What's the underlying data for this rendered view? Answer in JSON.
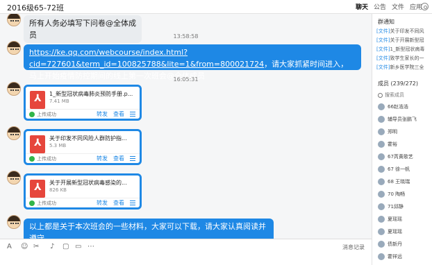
{
  "window": {
    "title": "2016级65-72班"
  },
  "tabs": [
    "聊天",
    "公告",
    "文件",
    "应用"
  ],
  "colors": {
    "bubble_blue": "#1e88e5",
    "bubble_grey": "#e9ecef",
    "pdf_red": "#e6463c",
    "ok_green": "#32b54a"
  },
  "messages": {
    "m1": "所有人务必填写下问卷@全体成员",
    "t1": "13:58:58",
    "m2_link": "https://ke.qq.com/webcourse/index.html?cid=727601&term_id=100825788&lite=1&from=800021724",
    "m2_text": "，请大家抓紧时间进入，马上开始疫情防控期间的线上第一次班会@全体成员",
    "t2": "16:05:31",
    "m3": "以上都是关于本次班会的一些材料，大家可以下载，请大家认真阅读并遵守"
  },
  "files": [
    {
      "name": "1_新型冠状病毒肺炎预防手册.p...",
      "size": "7.41 MB",
      "status": "上传成功",
      "forward": "转发",
      "view": "查看"
    },
    {
      "name": "关于印发不同风险人群防护指...",
      "size": "5.3 MB",
      "status": "上传成功",
      "forward": "转发",
      "view": "查看"
    },
    {
      "name": "关于开展新型冠状病毒感染的...",
      "size": "826 KB",
      "status": "上传成功",
      "forward": "转发",
      "view": "查看"
    }
  ],
  "input": {
    "history": "消息记录"
  },
  "sidebar": {
    "notice_title": "群通知",
    "notices": [
      {
        "tag": "[文件]",
        "text": "关于印发不同风"
      },
      {
        "tag": "[文件]",
        "text": "关于开展新型冠"
      },
      {
        "tag": "[文件]",
        "text": "1_新型冠状病毒"
      },
      {
        "tag": "[文件]",
        "text": "致学生家长的一"
      },
      {
        "tag": "[文件]",
        "text": "新乡医学院三全"
      }
    ],
    "members_title": "成员 (239/272)",
    "search_placeholder": "搜索成员",
    "members": [
      "66赵浩浩",
      "辅导员张鹏飞",
      "郑明",
      "霍裕",
      "67芮黄歌艺",
      "67 徐一帆",
      "68 王晓瑞",
      "70 陶畅",
      "71邱静",
      "夏瑶瑶",
      "夏瑶瑶",
      "债新丹",
      "霍祥远"
    ]
  }
}
